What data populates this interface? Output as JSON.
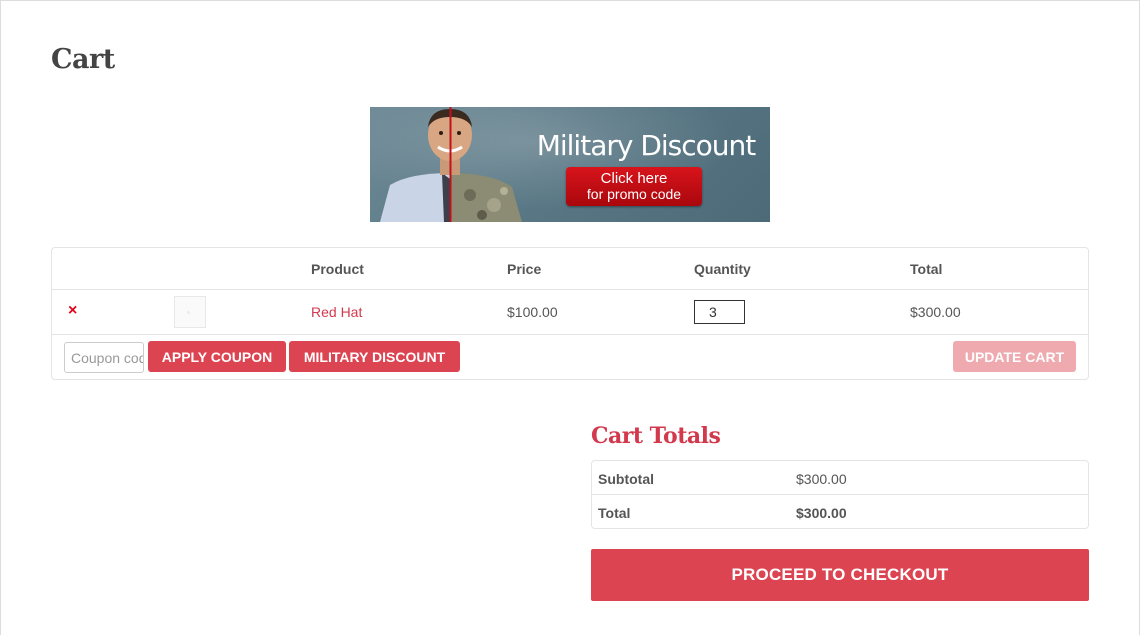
{
  "page": {
    "title": "Cart"
  },
  "banner": {
    "headline": "Military Discount",
    "cta_line1": "Click here",
    "cta_line2": "for promo code"
  },
  "cart": {
    "headers": [
      "",
      "",
      "Product",
      "Price",
      "Quantity",
      "Total"
    ],
    "items": [
      {
        "remove_icon": "×",
        "product": "Red Hat",
        "price": "$100.00",
        "quantity": "3",
        "total": "$300.00"
      }
    ],
    "coupon_placeholder": "Coupon code",
    "apply_label": "Apply Coupon",
    "military_label": "Military Discount",
    "update_label": "Update Cart"
  },
  "totals": {
    "title": "Cart Totals",
    "subtotal_label": "Subtotal",
    "subtotal_value": "$300.00",
    "total_label": "Total",
    "total_value": "$300.00",
    "checkout_label": "Proceed to Checkout"
  },
  "colors": {
    "accent": "#dd4452",
    "link": "#d3394c",
    "remove": "#e2001a"
  }
}
